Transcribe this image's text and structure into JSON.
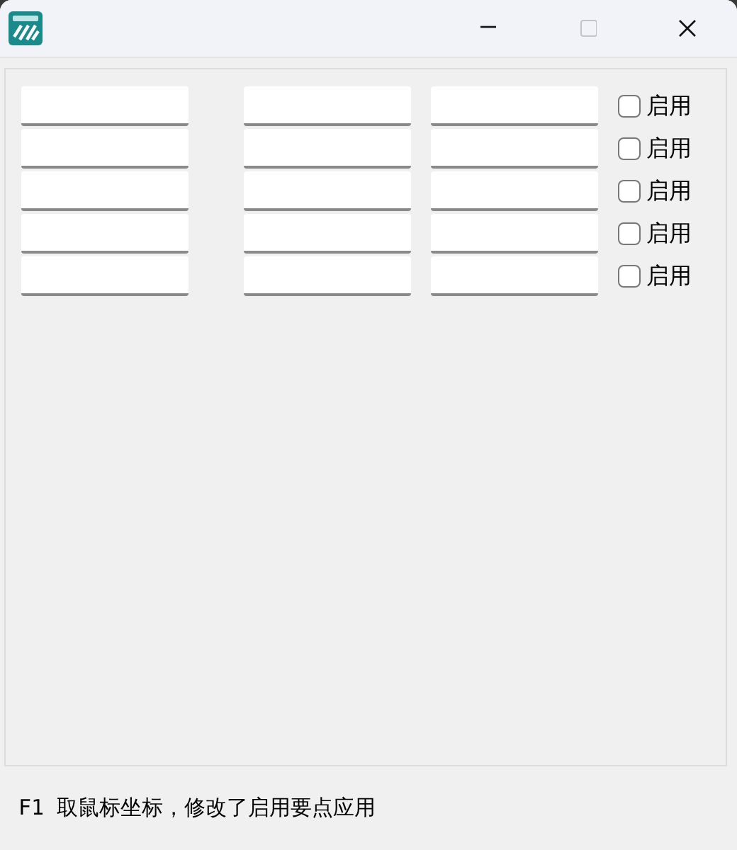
{
  "title_bar": {
    "controls": [
      {
        "kind": "minimize",
        "disabled": false
      },
      {
        "kind": "maximize",
        "disabled": true
      },
      {
        "kind": "close",
        "disabled": false
      }
    ]
  },
  "rows": [
    {
      "fields": [
        {
          "kind": "input"
        },
        {
          "kind": "input"
        },
        {
          "kind": "input"
        }
      ],
      "checkbox": {
        "label": "启用",
        "checked": false
      }
    },
    {
      "fields": [
        {
          "kind": "input"
        },
        {
          "kind": "input"
        },
        {
          "kind": "input"
        }
      ],
      "checkbox": {
        "label": "启用",
        "checked": false
      }
    },
    {
      "fields": [
        {
          "kind": "input"
        },
        {
          "kind": "input"
        },
        {
          "kind": "input"
        }
      ],
      "checkbox": {
        "label": "启用",
        "checked": false
      }
    },
    {
      "fields": [
        {
          "kind": "input"
        },
        {
          "kind": "input"
        },
        {
          "kind": "input"
        }
      ],
      "checkbox": {
        "label": "启用",
        "checked": false
      }
    },
    {
      "fields": [
        {
          "kind": "input"
        },
        {
          "kind": "input"
        },
        {
          "kind": "input"
        }
      ],
      "checkbox": {
        "label": "启用",
        "checked": false
      }
    }
  ],
  "status_bar": {
    "text": "F1 取鼠标坐标，修改了启用要点应用"
  }
}
